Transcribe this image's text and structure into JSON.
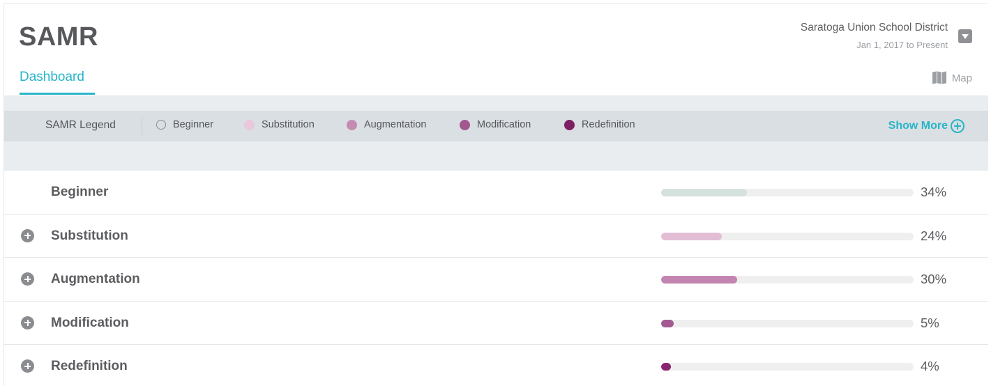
{
  "header": {
    "title": "SAMR",
    "tab": "Dashboard",
    "district_name": "Saratoga Union School District",
    "district_date": "Jan 1, 2017 to Present",
    "map_label": "Map"
  },
  "legend": {
    "title": "SAMR Legend",
    "items": [
      {
        "label": "Beginner",
        "color": "#ffffff"
      },
      {
        "label": "Substitution",
        "color": "#e9c8dc"
      },
      {
        "label": "Augmentation",
        "color": "#c58bb3"
      },
      {
        "label": "Modification",
        "color": "#a2578f"
      },
      {
        "label": "Redefinition",
        "color": "#7e1e63"
      }
    ],
    "show_more": "Show More"
  },
  "rows": [
    {
      "label": "Beginner",
      "percent": 34,
      "percent_text": "34%",
      "color": "#d5e1dc",
      "expandable": false
    },
    {
      "label": "Substitution",
      "percent": 24,
      "percent_text": "24%",
      "color": "#e2bdd4",
      "expandable": true
    },
    {
      "label": "Augmentation",
      "percent": 30,
      "percent_text": "30%",
      "color": "#c285b0",
      "expandable": true
    },
    {
      "label": "Modification",
      "percent": 5,
      "percent_text": "5%",
      "color": "#a25a91",
      "expandable": true
    },
    {
      "label": "Redefinition",
      "percent": 4,
      "percent_text": "4%",
      "color": "#8a266f",
      "expandable": true
    }
  ]
}
